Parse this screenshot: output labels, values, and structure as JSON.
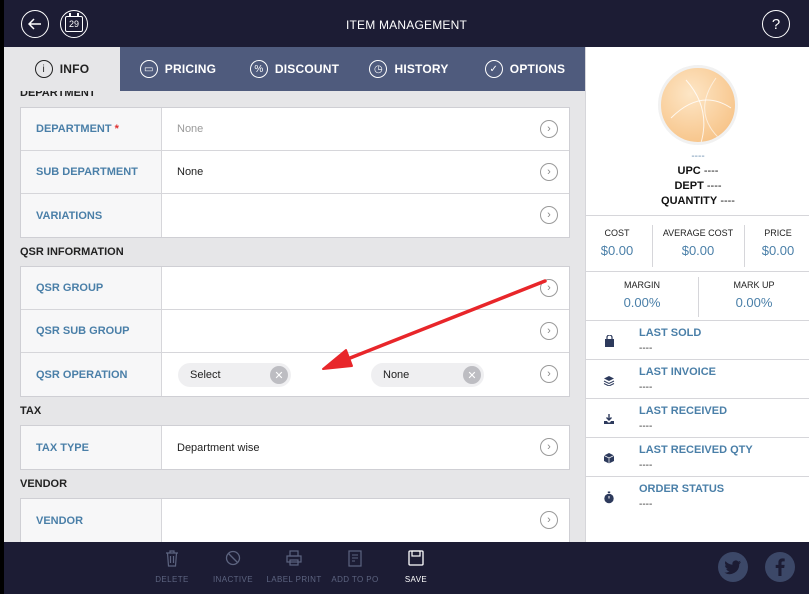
{
  "header": {
    "title": "ITEM MANAGEMENT",
    "calendar_day": "29",
    "back_icon": "arrow-left-icon",
    "help_label": "?"
  },
  "tabs": [
    {
      "label": "INFO",
      "icon": "i",
      "active": true
    },
    {
      "label": "PRICING",
      "icon": "▭"
    },
    {
      "label": "DISCOUNT",
      "icon": "%"
    },
    {
      "label": "HISTORY",
      "icon": "◷"
    },
    {
      "label": "OPTIONS",
      "icon": "✓"
    }
  ],
  "sections": {
    "department": {
      "title": "DEPARTMENT",
      "rows": [
        {
          "label": "DEPARTMENT",
          "required_mark": "*",
          "value": "None"
        },
        {
          "label": "SUB DEPARTMENT",
          "value": "None"
        },
        {
          "label": "VARIATIONS",
          "value": ""
        }
      ]
    },
    "qsr": {
      "title": "QSR INFORMATION",
      "rows": [
        {
          "label": "QSR GROUP",
          "value": ""
        },
        {
          "label": "QSR SUB GROUP",
          "value": ""
        },
        {
          "label": "QSR OPERATION",
          "select1": "Select",
          "select2": "None"
        }
      ]
    },
    "tax": {
      "title": "TAX",
      "rows": [
        {
          "label": "TAX TYPE",
          "value": "Department wise"
        }
      ]
    },
    "vendor": {
      "title": "VENDOR",
      "rows": [
        {
          "label": "VENDOR",
          "value": ""
        }
      ]
    }
  },
  "summary": {
    "name": "----",
    "upc_label": "UPC",
    "upc_value": "----",
    "dept_label": "DEPT",
    "dept_value": "----",
    "qty_label": "QUANTITY",
    "qty_value": "----",
    "cost_label": "COST",
    "cost_value": "$0.00",
    "avg_cost_label": "AVERAGE COST",
    "avg_cost_value": "$0.00",
    "price_label": "PRICE",
    "price_value": "$0.00",
    "margin_label": "MARGIN",
    "margin_value": "0.00%",
    "markup_label": "MARK UP",
    "markup_value": "0.00%",
    "info": [
      {
        "label": "LAST SOLD",
        "value": "----",
        "icon": "bag-icon"
      },
      {
        "label": "LAST INVOICE",
        "value": "----",
        "icon": "stack-icon"
      },
      {
        "label": "LAST RECEIVED",
        "value": "----",
        "icon": "tray-download-icon"
      },
      {
        "label": "LAST RECEIVED QTY",
        "value": "----",
        "icon": "box-icon"
      },
      {
        "label": "ORDER STATUS",
        "value": "----",
        "icon": "stopwatch-icon"
      }
    ]
  },
  "toolbar": {
    "delete": "DELETE",
    "inactive": "INACTIVE",
    "label_print": "LABEL PRINT",
    "add_to_po": "ADD TO PO",
    "save": "SAVE"
  },
  "colors": {
    "navy": "#1c1c34",
    "tab_bar": "#4f5b7d",
    "accent_blue": "#4a7fa8",
    "annotation_red": "#e8262a"
  }
}
